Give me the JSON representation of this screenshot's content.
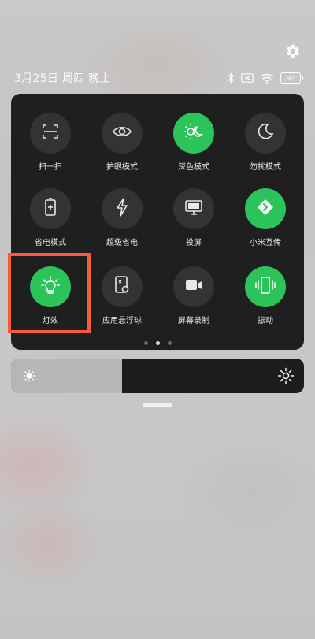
{
  "status": {
    "datetime": "3月25日 周四 晚上",
    "battery": "92"
  },
  "tiles": [
    {
      "label": "扫一扫",
      "icon": "scan-icon",
      "on": false
    },
    {
      "label": "护眼模式",
      "icon": "eye-icon",
      "on": false
    },
    {
      "label": "深色模式",
      "icon": "dark-mode-icon",
      "on": true
    },
    {
      "label": "勿扰模式",
      "icon": "moon-icon",
      "on": false
    },
    {
      "label": "省电模式",
      "icon": "battery-saver-icon",
      "on": false
    },
    {
      "label": "超级省电",
      "icon": "lightning-icon",
      "on": false
    },
    {
      "label": "投屏",
      "icon": "screen-cast-icon",
      "on": false
    },
    {
      "label": "小米互传",
      "icon": "mi-share-icon",
      "on": true
    },
    {
      "label": "灯效",
      "icon": "light-bulb-icon",
      "on": true
    },
    {
      "label": "应用悬浮球",
      "icon": "floating-ball-icon",
      "on": false
    },
    {
      "label": "屏幕录制",
      "icon": "video-camera-icon",
      "on": false
    },
    {
      "label": "振动",
      "icon": "vibrate-icon",
      "on": true
    }
  ],
  "page_indicator": {
    "total": 3,
    "current": 2
  },
  "brightness": {
    "level": 0.38
  },
  "colors": {
    "accent_green": "#2cc35b",
    "panel_bg": "#1f1f1f",
    "tile_off": "#333333",
    "highlight": "#ff5b3a"
  }
}
